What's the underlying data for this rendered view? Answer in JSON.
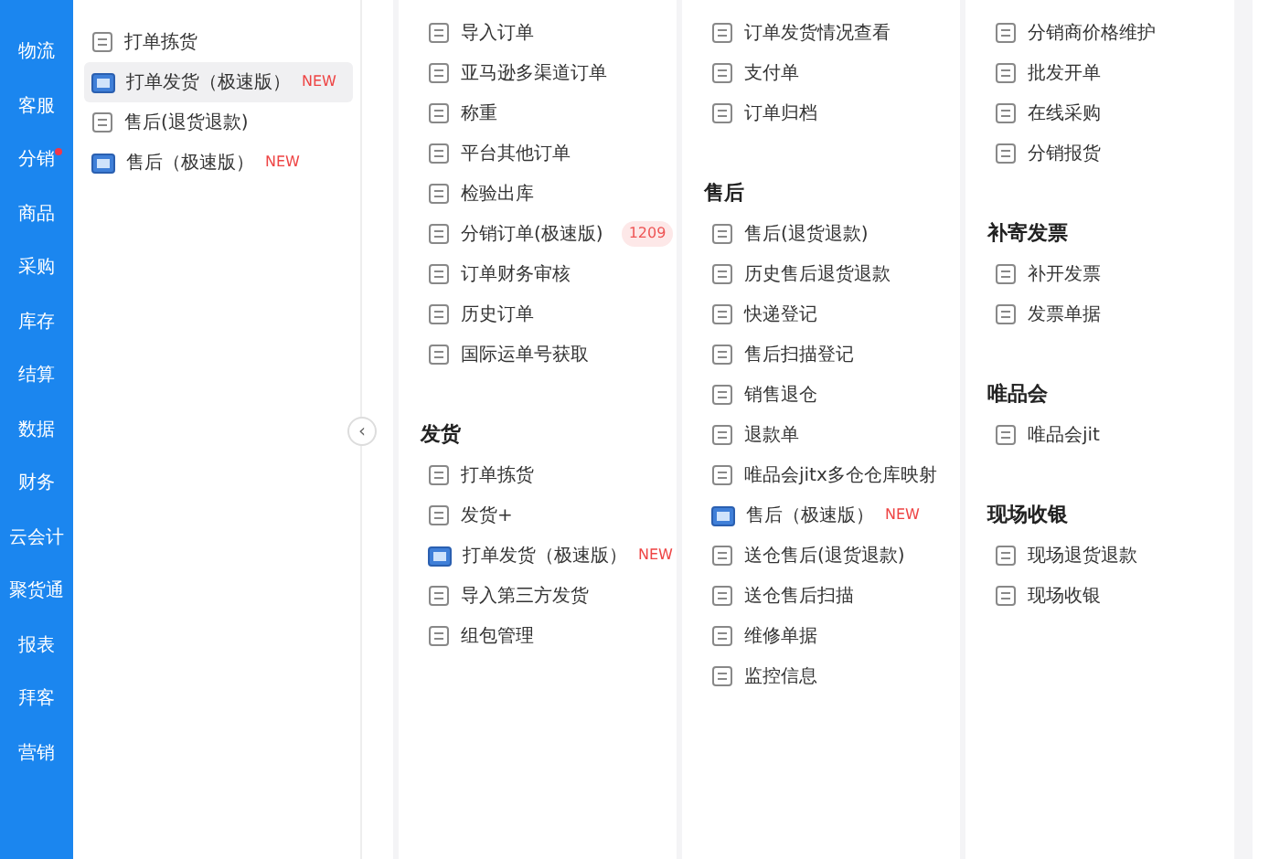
{
  "sidebar": {
    "items": [
      {
        "label": "物流",
        "dot": false
      },
      {
        "label": "客服",
        "dot": false
      },
      {
        "label": "分销",
        "dot": true
      },
      {
        "label": "商品",
        "dot": false
      },
      {
        "label": "采购",
        "dot": false
      },
      {
        "label": "库存",
        "dot": false
      },
      {
        "label": "结算",
        "dot": false
      },
      {
        "label": "数据",
        "dot": false
      },
      {
        "label": "财务",
        "dot": false
      },
      {
        "label": "云会计",
        "dot": false
      },
      {
        "label": "聚货通",
        "dot": false
      },
      {
        "label": "报表",
        "dot": false
      },
      {
        "label": "拜客",
        "dot": false
      },
      {
        "label": "营销",
        "dot": false
      }
    ]
  },
  "panel": {
    "items": [
      {
        "label": "打单拣货",
        "kind": "plain",
        "selected": false
      },
      {
        "label": "打单发货（极速版）",
        "kind": "fast",
        "tag": "NEW",
        "selected": true
      },
      {
        "label": "售后(退货退款)",
        "kind": "plain",
        "selected": false
      },
      {
        "label": "售后（极速版）",
        "kind": "fast",
        "tag": "NEW",
        "selected": false
      }
    ]
  },
  "collapse_button": {
    "label": "‹"
  },
  "columns": [
    {
      "sections": [
        {
          "items": [
            {
              "label": "导入订单",
              "kind": "plain"
            },
            {
              "label": "亚马逊多渠道订单",
              "kind": "plain"
            },
            {
              "label": "称重",
              "kind": "plain"
            },
            {
              "label": "平台其他订单",
              "kind": "plain"
            },
            {
              "label": "检验出库",
              "kind": "plain"
            },
            {
              "label": "分销订单(极速版)",
              "kind": "plain",
              "count": "1209"
            },
            {
              "label": "订单财务审核",
              "kind": "plain"
            },
            {
              "label": "历史订单",
              "kind": "plain"
            },
            {
              "label": "国际运单号获取",
              "kind": "plain"
            }
          ]
        },
        {
          "title": "发货",
          "items": [
            {
              "label": "打单拣货",
              "kind": "plain"
            },
            {
              "label": "发货+",
              "kind": "plain"
            },
            {
              "label": "打单发货（极速版）",
              "kind": "fast",
              "tag": "NEW"
            },
            {
              "label": "导入第三方发货",
              "kind": "plain"
            },
            {
              "label": "组包管理",
              "kind": "plain"
            }
          ]
        }
      ]
    },
    {
      "sections": [
        {
          "items": [
            {
              "label": "订单发货情况查看",
              "kind": "plain"
            },
            {
              "label": "支付单",
              "kind": "plain"
            },
            {
              "label": "订单归档",
              "kind": "plain"
            }
          ]
        },
        {
          "title": "售后",
          "items": [
            {
              "label": "售后(退货退款)",
              "kind": "plain"
            },
            {
              "label": "历史售后退货退款",
              "kind": "plain"
            },
            {
              "label": "快递登记",
              "kind": "plain"
            },
            {
              "label": "售后扫描登记",
              "kind": "plain"
            },
            {
              "label": "销售退仓",
              "kind": "plain"
            },
            {
              "label": "退款单",
              "kind": "plain"
            },
            {
              "label": "唯品会jitx多仓仓库映射",
              "kind": "plain"
            },
            {
              "label": "售后（极速版）",
              "kind": "fast",
              "tag": "NEW"
            },
            {
              "label": "送仓售后(退货退款)",
              "kind": "plain"
            },
            {
              "label": "送仓售后扫描",
              "kind": "plain"
            },
            {
              "label": "维修单据",
              "kind": "plain"
            },
            {
              "label": "监控信息",
              "kind": "plain"
            }
          ]
        }
      ]
    },
    {
      "sections": [
        {
          "items": [
            {
              "label": "分销商价格维护",
              "kind": "plain"
            },
            {
              "label": "批发开单",
              "kind": "plain"
            },
            {
              "label": "在线采购",
              "kind": "plain"
            },
            {
              "label": "分销报货",
              "kind": "plain"
            }
          ]
        },
        {
          "title": "补寄发票",
          "items": [
            {
              "label": "补开发票",
              "kind": "plain"
            },
            {
              "label": "发票单据",
              "kind": "plain"
            }
          ]
        },
        {
          "title": "唯品会",
          "items": [
            {
              "label": "唯品会jit",
              "kind": "plain"
            }
          ]
        },
        {
          "title": "现场收银",
          "items": [
            {
              "label": "现场退货退款",
              "kind": "plain"
            },
            {
              "label": "现场收银",
              "kind": "plain"
            }
          ]
        }
      ]
    }
  ]
}
